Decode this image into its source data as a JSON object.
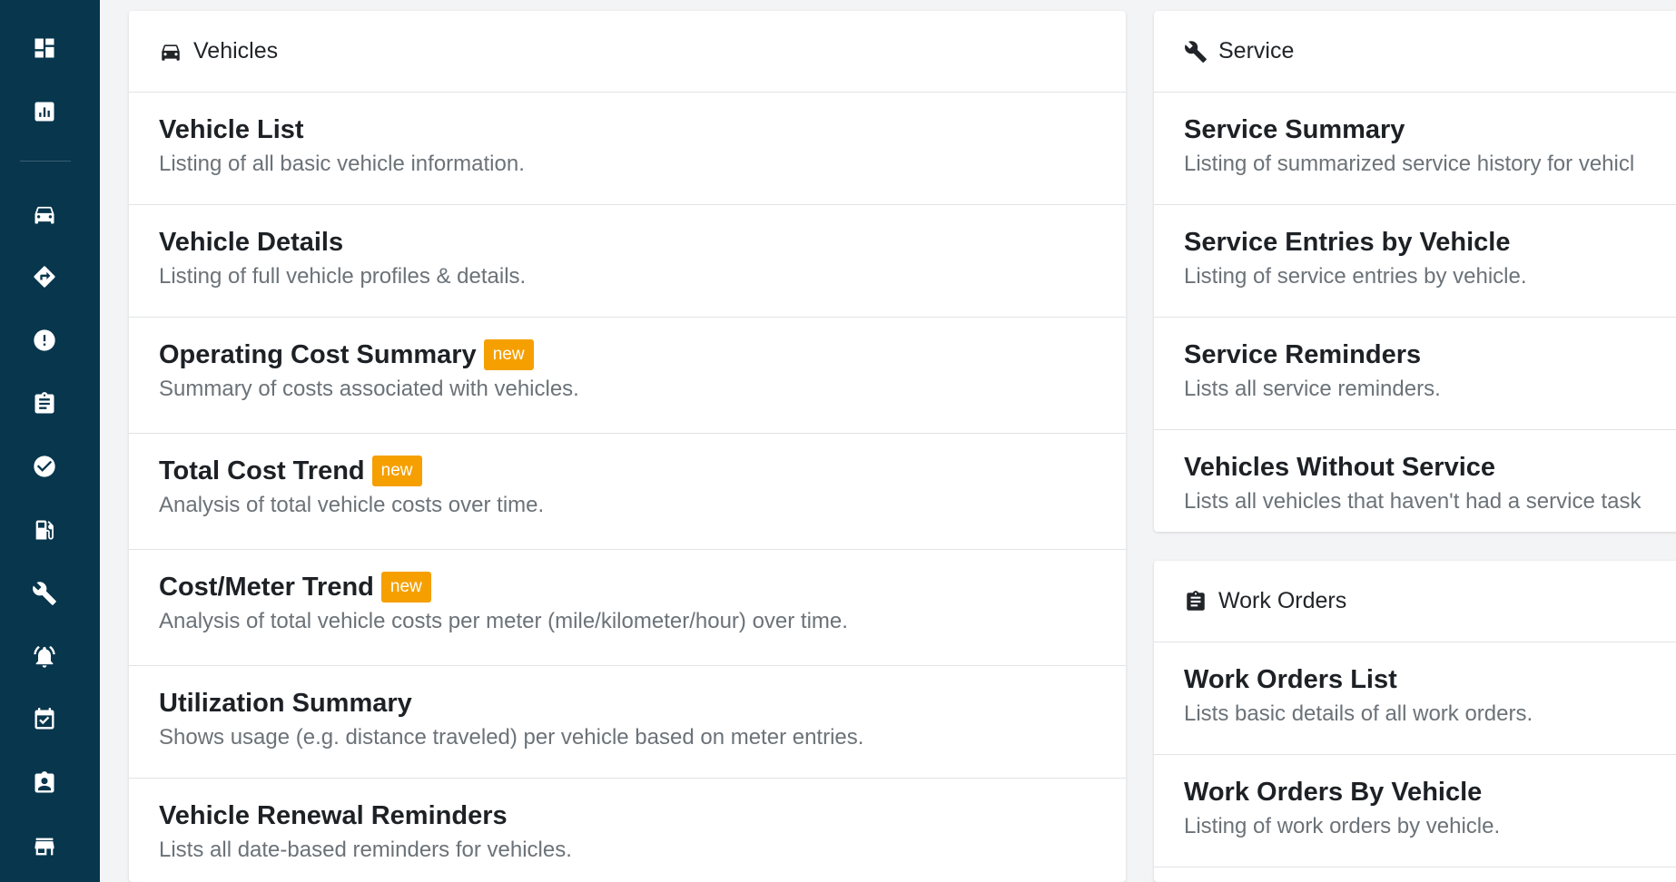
{
  "sidebar": {
    "icons": [
      "dashboard-icon",
      "reports-icon",
      "vehicles-icon",
      "routes-icon",
      "issues-icon",
      "inspections-icon",
      "checklist-icon",
      "fuel-icon",
      "service-icon",
      "reminders-icon",
      "calendar-icon",
      "contacts-icon",
      "vendors-icon"
    ]
  },
  "vehicles": {
    "title": "Vehicles",
    "items": [
      {
        "title": "Vehicle List",
        "desc": "Listing of all basic vehicle information.",
        "badge": ""
      },
      {
        "title": "Vehicle Details",
        "desc": "Listing of full vehicle profiles & details.",
        "badge": ""
      },
      {
        "title": "Operating Cost Summary",
        "desc": "Summary of costs associated with vehicles.",
        "badge": "new"
      },
      {
        "title": "Total Cost Trend",
        "desc": "Analysis of total vehicle costs over time.",
        "badge": "new"
      },
      {
        "title": "Cost/Meter Trend",
        "desc": "Analysis of total vehicle costs per meter (mile/kilometer/hour) over time.",
        "badge": "new"
      },
      {
        "title": "Utilization Summary",
        "desc": "Shows usage (e.g. distance traveled) per vehicle based on meter entries.",
        "badge": ""
      },
      {
        "title": "Vehicle Renewal Reminders",
        "desc": "Lists all date-based reminders for vehicles.",
        "badge": ""
      }
    ]
  },
  "service": {
    "title": "Service",
    "items": [
      {
        "title": "Service Summary",
        "desc": "Listing of summarized service history for vehicl"
      },
      {
        "title": "Service Entries by Vehicle",
        "desc": "Listing of service entries by vehicle."
      },
      {
        "title": "Service Reminders",
        "desc": "Lists all service reminders."
      },
      {
        "title": "Vehicles Without Service",
        "desc": "Lists all vehicles that haven't had a service task"
      }
    ]
  },
  "work_orders": {
    "title": "Work Orders",
    "items": [
      {
        "title": "Work Orders List",
        "desc": "Lists basic details of all work orders."
      },
      {
        "title": "Work Orders By Vehicle",
        "desc": "Listing of work orders by vehicle."
      }
    ]
  },
  "colors": {
    "sidebar_bg": "#07364d",
    "badge_bg": "#f5a000",
    "page_bg": "#f3f4f5"
  }
}
